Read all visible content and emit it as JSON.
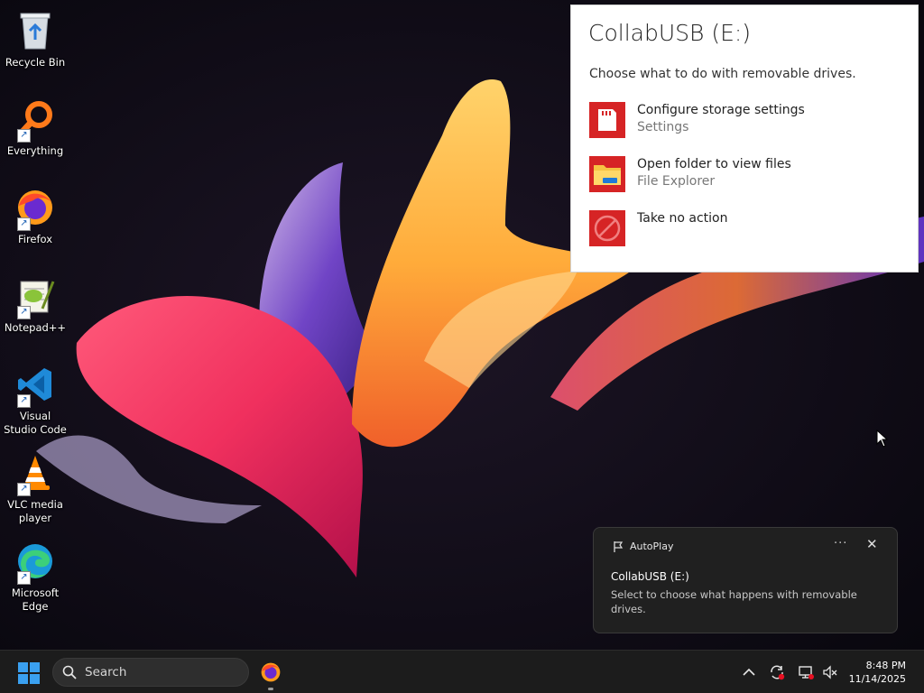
{
  "desktop": {
    "icons": [
      {
        "label": "Recycle Bin"
      },
      {
        "label": "Everything"
      },
      {
        "label": "Firefox"
      },
      {
        "label": "Notepad++"
      },
      {
        "label": "Visual Studio Code"
      },
      {
        "label": "VLC media player"
      },
      {
        "label": "Microsoft Edge"
      }
    ]
  },
  "autoplay_flyout": {
    "title": "CollabUSB (E:)",
    "subtitle": "Choose what to do with removable drives.",
    "options": [
      {
        "label": "Configure storage settings",
        "sublabel": "Settings",
        "icon": "sd-card-icon"
      },
      {
        "label": "Open folder to view files",
        "sublabel": "File Explorer",
        "icon": "folder-icon"
      },
      {
        "label": "Take no action",
        "sublabel": "",
        "icon": "no-action-icon"
      }
    ],
    "accent_color": "#d62425"
  },
  "toast": {
    "app_name": "AutoPlay",
    "more_label": "···",
    "close_label": "✕",
    "title": "CollabUSB (E:)",
    "body": "Select to choose what happens with removable drives."
  },
  "taskbar": {
    "search_placeholder": "Search",
    "clock_time": "8:48 PM",
    "clock_date": "11/14/2025"
  }
}
